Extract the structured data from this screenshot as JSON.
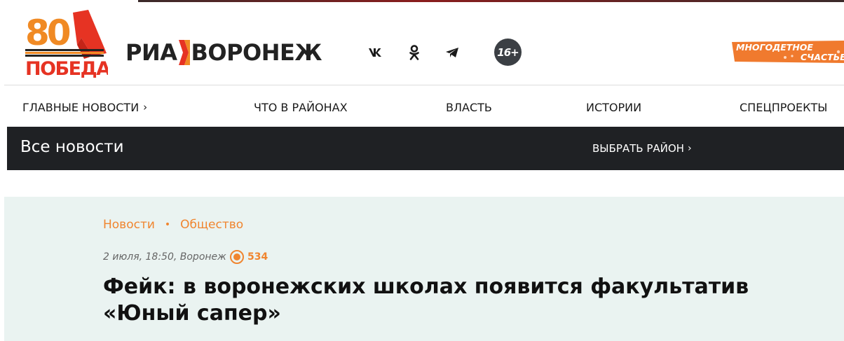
{
  "header": {
    "logo_victory": {
      "number": "80",
      "word": "ПОБЕДА!",
      "colors": {
        "red": "#e63323",
        "orange": "#f08a24",
        "ribbon_black": "#222222"
      }
    },
    "brand": {
      "left": "РИА",
      "right": "ВОРОНЕЖ",
      "accent": "#e63323"
    },
    "social": [
      {
        "name": "vk-icon",
        "glyph": "vk"
      },
      {
        "name": "odnoklassniki-icon",
        "glyph": "ok"
      },
      {
        "name": "telegram-icon",
        "glyph": "telegram"
      }
    ],
    "age_rating": "16+",
    "banner": {
      "line1": "МНОГОДЕТНОЕ",
      "line2": "СЧАСТЬЕ",
      "color": "#f07a2e"
    }
  },
  "nav": {
    "items": [
      {
        "label": "ГЛАВНЫЕ НОВОСТИ",
        "chevron": "›"
      },
      {
        "label": "ЧТО В РАЙОНАХ"
      },
      {
        "label": "ВЛАСТЬ"
      },
      {
        "label": "ИСТОРИИ"
      },
      {
        "label": "СПЕЦПРОЕКТЫ"
      }
    ]
  },
  "news_bar": {
    "title": "Все новости",
    "region_label": "ВЫБРАТЬ РАЙОН",
    "chevron": "›"
  },
  "article": {
    "breadcrumbs": [
      "Новости",
      "Общество"
    ],
    "separator": "•",
    "meta": "2 июля, 18:50, Воронеж",
    "views": "534",
    "headline_line1": "Фейк: в воронежских школах появится факультатив",
    "headline_line2": "«Юный сапер»",
    "accent": "#f0852f",
    "background": "#eaf3f1"
  }
}
